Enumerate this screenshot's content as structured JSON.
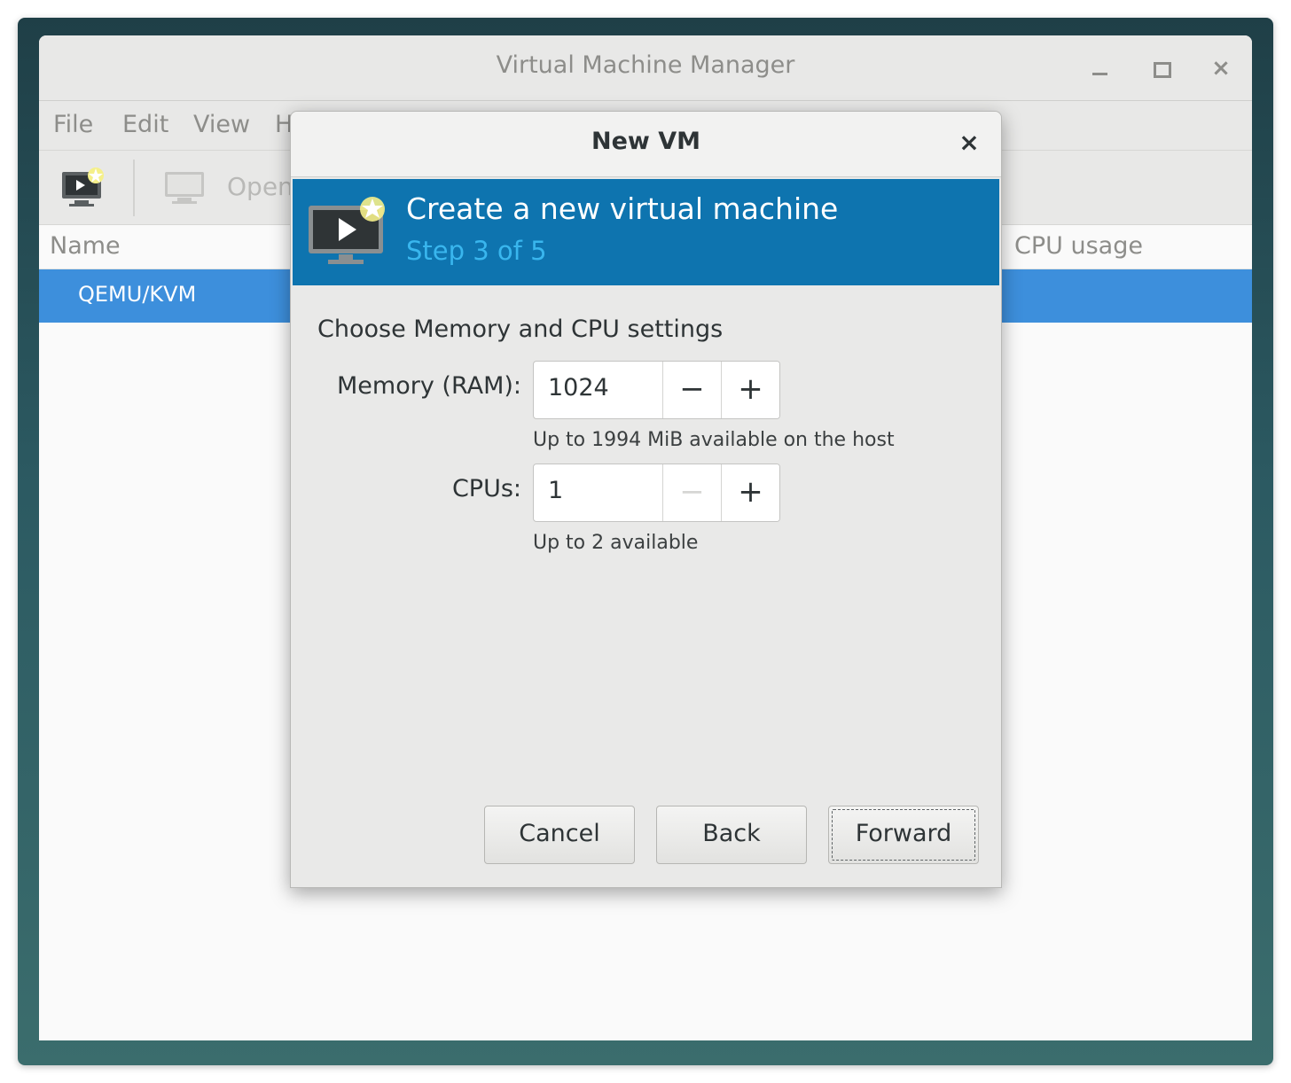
{
  "main_window": {
    "title": "Virtual Machine Manager",
    "menu": [
      "File",
      "Edit",
      "View",
      "H"
    ],
    "toolbar": {
      "open_label": "Open"
    },
    "columns": {
      "name": "Name",
      "cpu_usage": "CPU usage"
    },
    "rows": [
      {
        "label": "QEMU/KVM",
        "selected": true
      }
    ]
  },
  "dialog": {
    "title": "New VM",
    "banner": {
      "title": "Create a new virtual machine",
      "subtitle": "Step 3 of 5",
      "icon": "new-vm-icon"
    },
    "section_label": "Choose Memory and CPU settings",
    "memory": {
      "label": "Memory (RAM):",
      "value": "1024",
      "hint": "Up to 1994 MiB available on the host"
    },
    "cpus": {
      "label": "CPUs:",
      "value": "1",
      "hint": "Up to 2 available"
    },
    "buttons": {
      "cancel": "Cancel",
      "back": "Back",
      "forward": "Forward"
    }
  },
  "colors": {
    "banner": "#0e74af",
    "banner_subtitle": "#39b6ee",
    "selection": "#3d8fdc"
  }
}
